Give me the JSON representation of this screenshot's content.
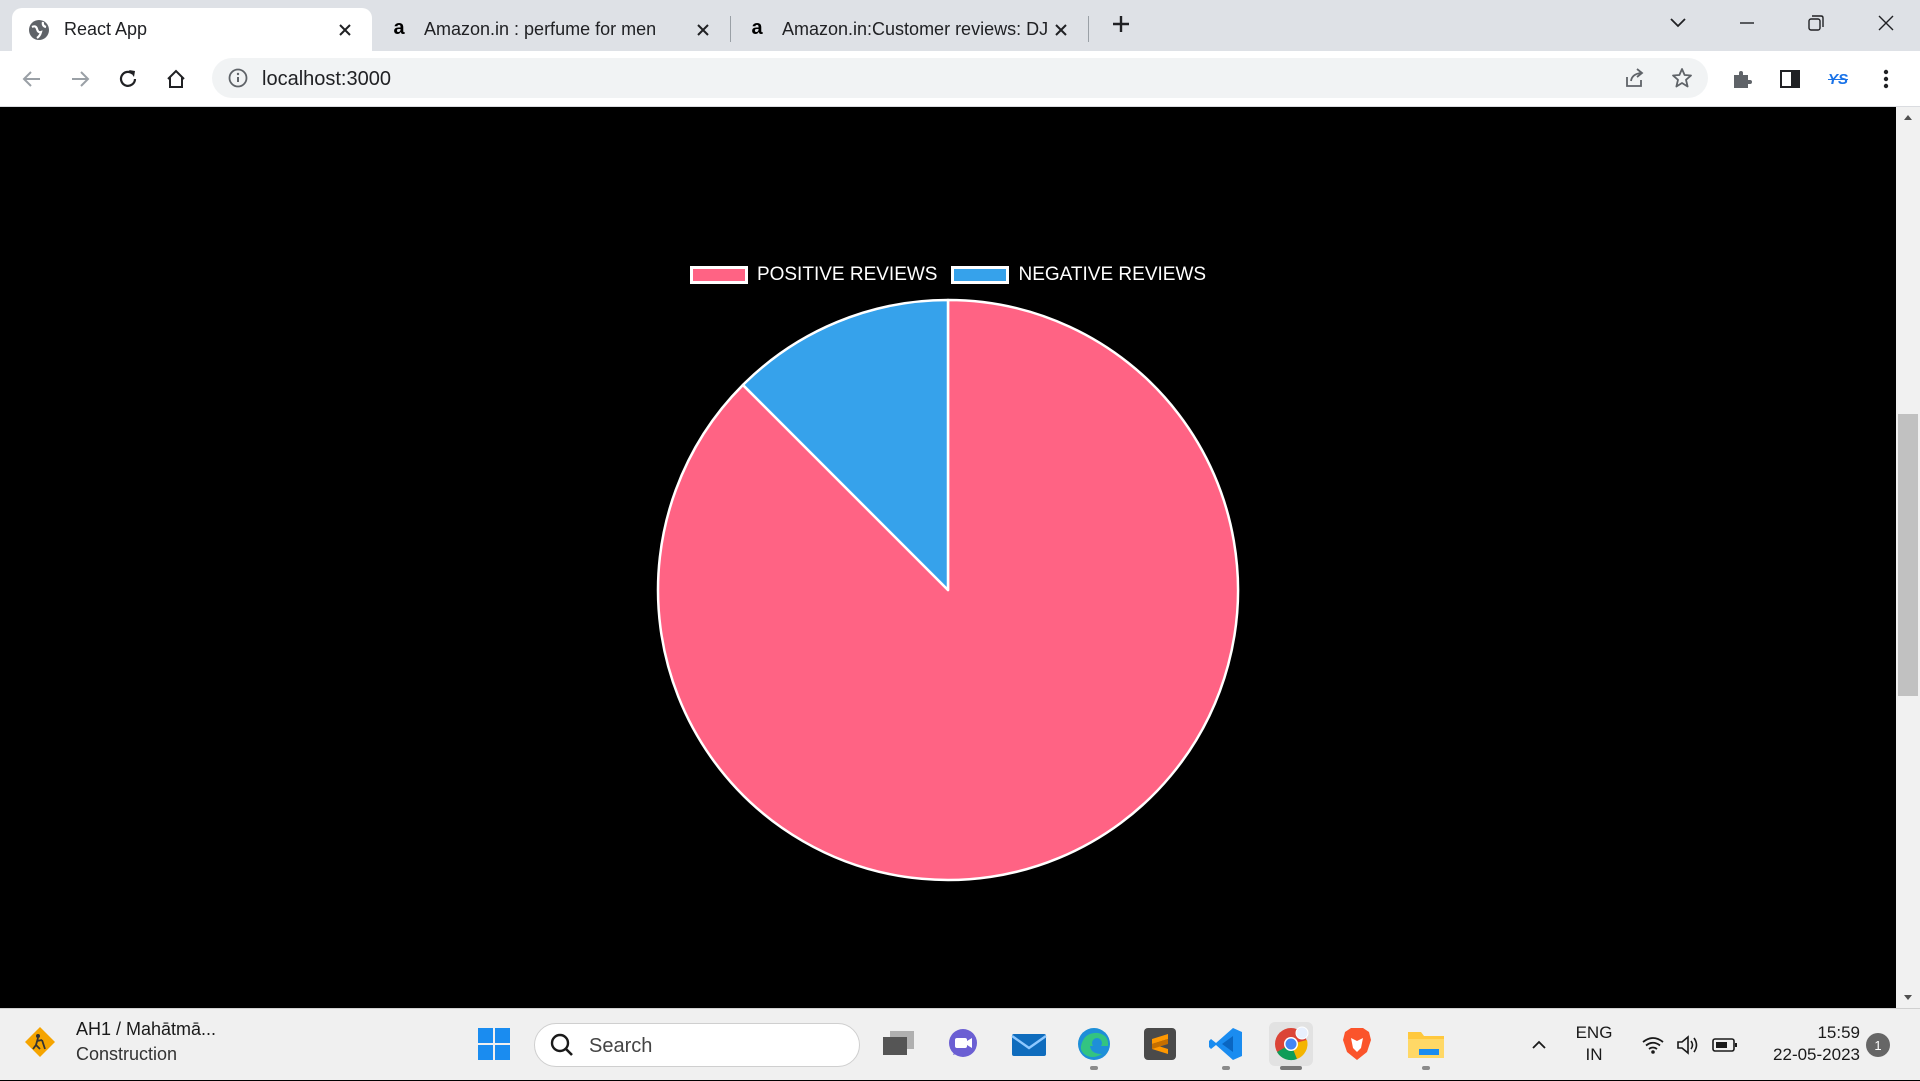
{
  "browser": {
    "tabs": [
      {
        "title": "React App",
        "favicon": "globe-icon",
        "active": true
      },
      {
        "title": "Amazon.in : perfume for men",
        "favicon": "amazon-icon",
        "active": false
      },
      {
        "title": "Amazon.in:Customer reviews: DJ",
        "favicon": "amazon-icon",
        "active": false
      }
    ],
    "url": "localhost:3000",
    "profile_initials": "YS"
  },
  "chart_data": {
    "type": "pie",
    "series": [
      {
        "name": "POSITIVE REVIEWS",
        "value": 87.5,
        "color": "#ff6384"
      },
      {
        "name": "NEGATIVE REVIEWS",
        "value": 12.5,
        "color": "#36a2eb"
      }
    ],
    "legend_position": "top",
    "border_color": "#ffffff"
  },
  "taskbar": {
    "weather_line1": "AH1 / Mahātmā...",
    "weather_line2": "Construction",
    "search_placeholder": "Search",
    "lang_line1": "ENG",
    "lang_line2": "IN",
    "time": "15:59",
    "date": "22-05-2023",
    "notification_count": "1"
  },
  "colors": {
    "page_background": "#000000",
    "tabstrip": "#dee1e6",
    "positive": "#ff6384",
    "negative": "#36a2eb"
  }
}
